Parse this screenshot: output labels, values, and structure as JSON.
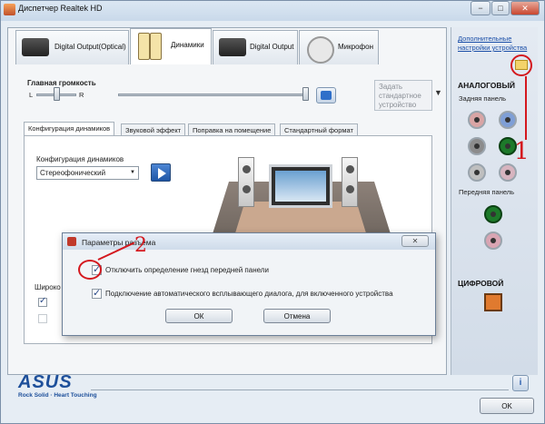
{
  "window": {
    "title": "Диспетчер Realtek HD",
    "buttons": [
      "−",
      "□",
      "✕"
    ]
  },
  "device_tabs": [
    "Digital Output(Optical)",
    "Динамики",
    "Digital Output",
    "Микрофон"
  ],
  "volume": {
    "label": "Главная громкость",
    "left": "L",
    "right": "R",
    "default_device": "Задать стандартное устройство"
  },
  "sub_tabs": [
    "Конфигурация динамиков",
    "Звуковой эффект",
    "Поправка на помещение",
    "Стандартный формат"
  ],
  "speaker_config": {
    "label": "Конфигурация динамиков",
    "selected": "Стереофонический",
    "partial_label": "Широко"
  },
  "right_panel": {
    "adv_link": "Дополнительные настройки устройства",
    "analog_title": "АНАЛОГОВЫЙ",
    "back_panel": "Задняя панель",
    "front_panel": "Передняя панель",
    "digital_title": "ЦИФРОВОЙ",
    "colors": {
      "pink": "#d9a5a5",
      "blue": "#7f9fd6",
      "gray": "#8c8c8c",
      "green": "#1d7a2a",
      "lightgray": "#bfbfbf",
      "lightpink": "#d7b4bf",
      "orange": "#e07a2f"
    }
  },
  "dialog": {
    "title": "Параметры разъема",
    "close": "✕",
    "option1": "Отключить определение гнезд передней панели",
    "option2": "Подключение автоматического всплывающего диалога, для включенного устройства",
    "ok": "ОК",
    "cancel": "Отмена"
  },
  "annotations": {
    "num1": "1",
    "num2": "2"
  },
  "footer": {
    "brand": "ASUS",
    "tagline": "Rock Solid · Heart Touching",
    "ok": "OK",
    "info": "i"
  }
}
